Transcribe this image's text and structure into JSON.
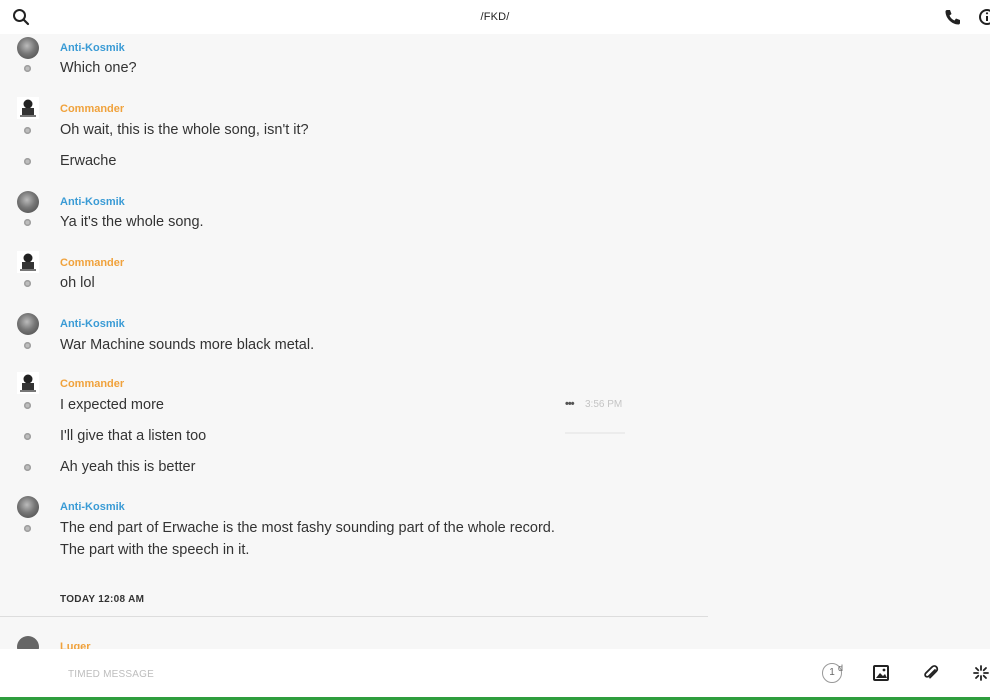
{
  "header": {
    "title": "/FKD/",
    "icons": [
      "search-icon",
      "phone-icon",
      "info-icon"
    ]
  },
  "messages": [
    {
      "author": "Anti-Kosmik",
      "lines": [
        "Which one?"
      ]
    },
    {
      "author": "Commander",
      "lines": [
        "Oh wait, this is the whole song, isn't it?",
        "Erwache"
      ]
    },
    {
      "author": "Anti-Kosmik",
      "lines": [
        "Ya it's the whole song."
      ]
    },
    {
      "author": "Commander",
      "lines": [
        "oh lol"
      ]
    },
    {
      "author": "Anti-Kosmik",
      "lines": [
        "War Machine sounds more black metal."
      ]
    },
    {
      "author": "Commander",
      "lines": [
        "I expected more",
        "I'll give that a listen too",
        "Ah yeah this is better"
      ]
    },
    {
      "author": "Anti-Kosmik",
      "lines": [
        "The end part of Erwache is the most fashy sounding part of the whole record.",
        "The part with the speech in it."
      ]
    }
  ],
  "hover_time": "3:56 PM",
  "date_separator": "TODAY 12:08 AM",
  "next_author": "Luger",
  "composer": {
    "placeholder": "TIMED MESSAGE",
    "timer_value": "1",
    "timer_unit": "d"
  },
  "colors": {
    "anti_kosmik": "#3a9bd5",
    "commander": "#f0a23c",
    "accent_bar": "#2e9e3e"
  }
}
